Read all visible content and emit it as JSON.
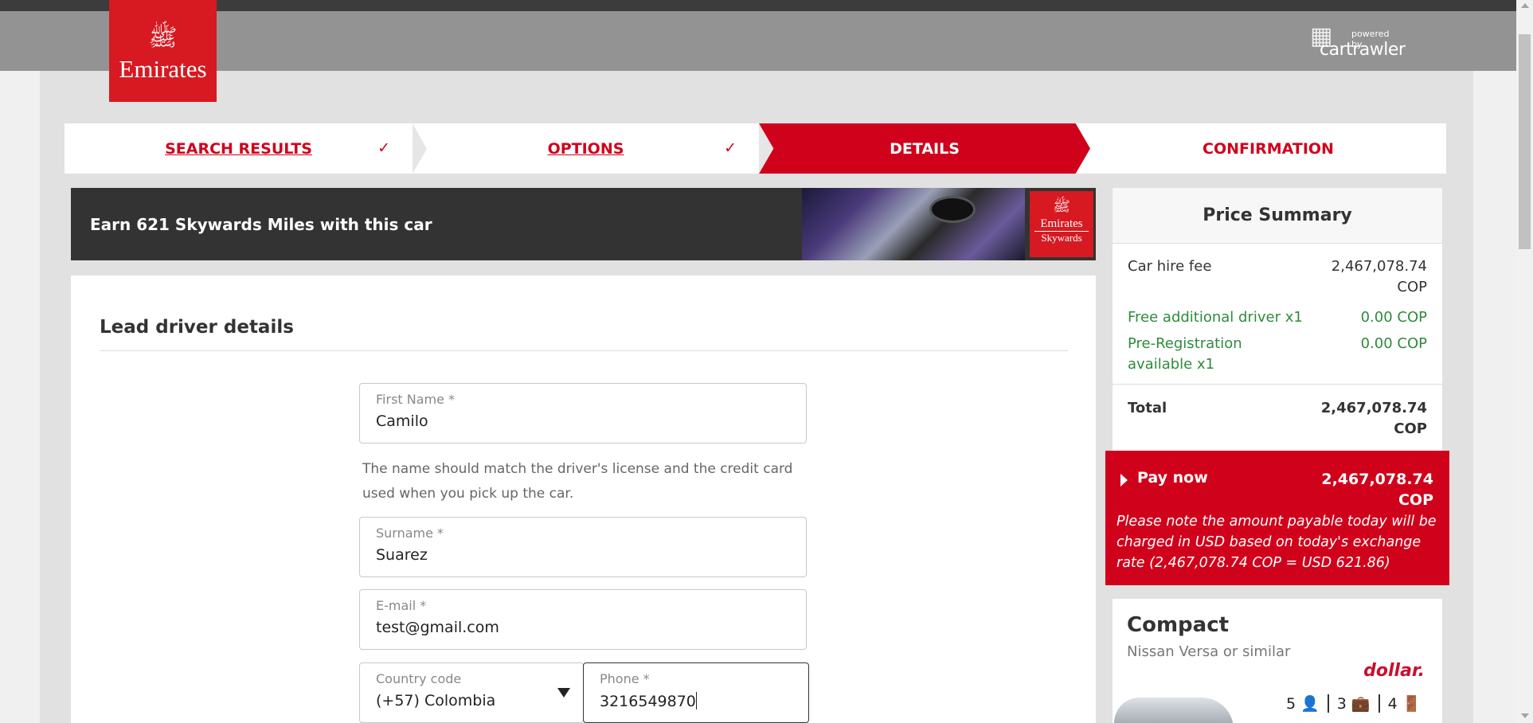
{
  "brand": {
    "logo_glyph": "ﷺ",
    "logo_word": "Emirates",
    "poweredby": "powered by",
    "partner": "cartrawler",
    "partner_mark": "▦"
  },
  "steps": [
    {
      "label": "SEARCH RESULTS",
      "done": true
    },
    {
      "label": "OPTIONS",
      "done": true
    },
    {
      "label": "DETAILS",
      "active": true
    },
    {
      "label": "CONFIRMATION"
    }
  ],
  "check_glyph": "✓",
  "banner": {
    "text": "Earn 621 Skywards Miles with this car",
    "sky_glyph": "ﷺ",
    "sky_a": "Emirates",
    "sky_b": "Skywards"
  },
  "form": {
    "heading": "Lead driver details",
    "first_name": {
      "label": "First Name *",
      "value": "Camilo"
    },
    "hint": "The name should match the driver's license and the credit card used when you pick up the car.",
    "surname": {
      "label": "Surname *",
      "value": "Suarez"
    },
    "email": {
      "label": "E-mail *",
      "value": "test@gmail.com"
    },
    "country": {
      "label": "Country code",
      "value": "(+57) Colombia"
    },
    "phone": {
      "label": "Phone *",
      "value": "3216549870"
    }
  },
  "summary": {
    "title": "Price Summary",
    "rows": [
      {
        "label": "Car hire fee",
        "amount": "2,467,078.74 COP"
      },
      {
        "label": "Free additional driver x1",
        "amount": "0.00 COP"
      },
      {
        "label": "Pre-Registration available x1",
        "amount": "0.00 COP"
      }
    ],
    "total_label": "Total",
    "total_amount": "2,467,078.74 COP"
  },
  "pay": {
    "label": "Pay now",
    "amount": "2,467,078.74 COP",
    "note": "Please note the amount payable today will be charged in USD based on today's exchange rate (2,467,078.74 COP = USD 621.86)"
  },
  "car": {
    "category": "Compact",
    "model": "Nissan Versa or similar",
    "supplier": "dollar.",
    "seats": "5 👤",
    "bags": "3 💼",
    "doors": "4 🚪"
  },
  "colors": {
    "accent": "#d0021b",
    "header": "#939393",
    "green": "#2e8b3a"
  }
}
